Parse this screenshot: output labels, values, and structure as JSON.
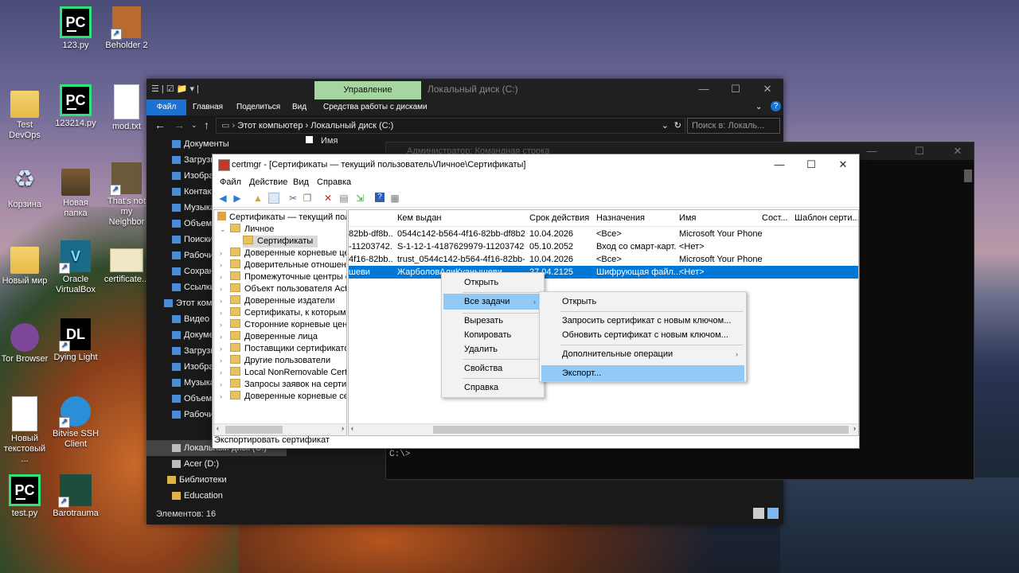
{
  "desktop": {
    "icons": [
      {
        "label": "123.py"
      },
      {
        "label": "Beholder 2"
      },
      {
        "label": "Test DevOps"
      },
      {
        "label": "123214.py"
      },
      {
        "label": "mod.txt"
      },
      {
        "label": "Корзина"
      },
      {
        "label": "Новая папка"
      },
      {
        "label": "That's not my Neighbor"
      },
      {
        "label": "Новый мир"
      },
      {
        "label": "Oracle VirtualBox"
      },
      {
        "label": "certificate..."
      },
      {
        "label": "Tor Browser"
      },
      {
        "label": "Dying Light"
      },
      {
        "label": "Новый текстовый ..."
      },
      {
        "label": "Bitvise SSH Client"
      },
      {
        "label": "test.py"
      },
      {
        "label": "Barotrauma"
      }
    ]
  },
  "explorer": {
    "qat": "☰ | ☑ 📁 ▾ |",
    "manage_tab": "Управление",
    "title": "Локальный диск (C:)",
    "ribbon": [
      "Файл",
      "Главная",
      "Поделиться",
      "Вид",
      "Средства работы с дисками"
    ],
    "path": [
      "Этот компьютер",
      "Локальный диск (C:)"
    ],
    "search_placeholder": "Поиск в: Локаль...",
    "nav_items": [
      "Документы",
      "Загрузк",
      "Изобра",
      "Контакт",
      "Музыка",
      "Объемн",
      "Поиски",
      "Рабочи",
      "Сохран",
      "Ссылки",
      "Этот ком",
      "Видео",
      "Докуме",
      "Загрузк",
      "Изобра",
      "Музыка",
      "Объемн",
      "Рабочи",
      "Локальный диск (C:)",
      "Acer (D:)",
      "Библиотеки",
      "Education"
    ],
    "list_header": "Имя",
    "status": "Элементов: 16"
  },
  "cmd": {
    "title": "Администратор: Командная строка",
    "prompt": "C:\\>"
  },
  "certmgr": {
    "title": "certmgr - [Сертификаты — текущий пользователь\\Личное\\Сертификаты]",
    "menu": [
      "Файл",
      "Действие",
      "Вид",
      "Справка"
    ],
    "tree": [
      "Сертификаты — текущий польз",
      "Личное",
      "Сертификаты",
      "Доверенные корневые цент",
      "Доверительные отношения",
      "Промежуточные центры сер",
      "Объект пользователя Active",
      "Доверенные издатели",
      "Сертификаты, к которым нет",
      "Сторонние корневые центр",
      "Доверенные лица",
      "Поставщики сертификатов п",
      "Другие пользователи",
      "Local NonRemovable Certifica",
      "Запросы заявок на сертифик",
      "Доверенные корневые серти"
    ],
    "columns": [
      "Кем выдан",
      "Срок действия",
      "Назначения",
      "Имя",
      "Сост...",
      "Шаблон серти..."
    ],
    "rows": [
      {
        "c0": "82bb-df8b...",
        "c1": "0544c142-b564-4f16-82bb-df8b26...",
        "c2": "10.04.2026",
        "c3": "<Все>",
        "c4": "Microsoft Your Phone"
      },
      {
        "c0": "-11203742...",
        "c1": "S-1-12-1-4187629979-1120374206-...",
        "c2": "05.10.2052",
        "c3": "Вход со смарт-карт...",
        "c4": "<Нет>"
      },
      {
        "c0": "4f16-82bb...",
        "c1": "trust_0544c142-b564-4f16-82bb-df...",
        "c2": "10.04.2026",
        "c3": "<Все>",
        "c4": "Microsoft Your Phone"
      },
      {
        "c0": "шеви",
        "c1": "ЖарболовАлиКуанышеви",
        "c2": "27.04.2125",
        "c3": "Шифрующая файл...",
        "c4": "<Нет>"
      }
    ],
    "status": "Экспортировать сертификат"
  },
  "context_menu": [
    "Открыть",
    "Все задачи",
    "Вырезать",
    "Копировать",
    "Удалить",
    "Свойства",
    "Справка"
  ],
  "submenu": [
    "Открыть",
    "Запросить сертификат с новым ключом...",
    "Обновить сертификат с новым ключом...",
    "Дополнительные операции",
    "Экспорт..."
  ]
}
